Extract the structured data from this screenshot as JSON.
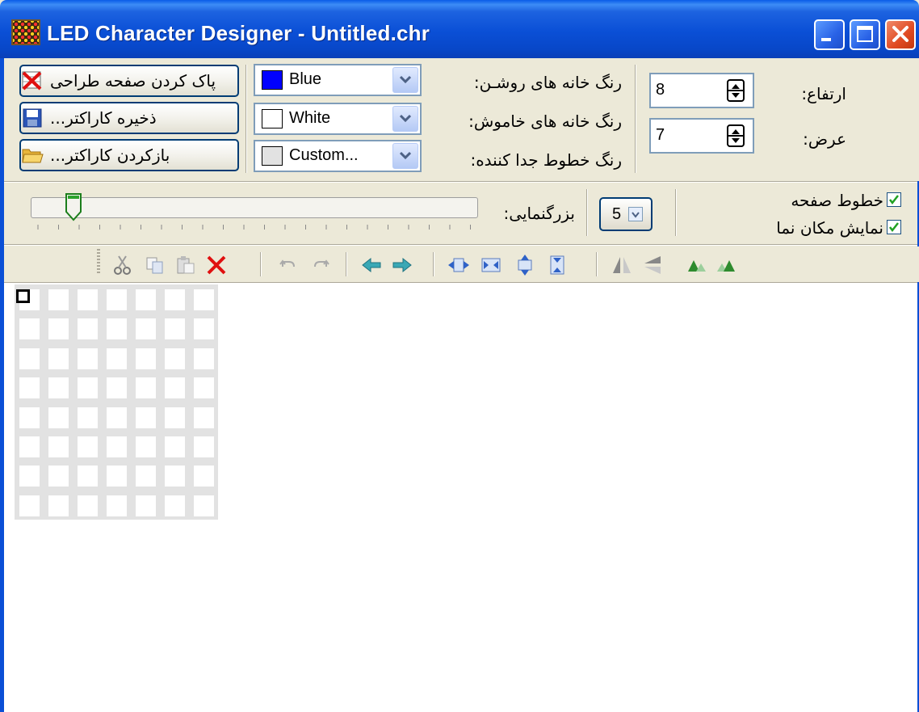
{
  "window": {
    "title": "LED Character Designer - Untitled.chr",
    "buttons": {
      "minimize": "minimize",
      "maximize": "maximize",
      "close": "close"
    }
  },
  "actions": {
    "clear_label": "پاک کردن صفحه طراحی",
    "save_label": "ذخیره کاراکتر...",
    "open_label": "بازکردن کاراکتر..."
  },
  "colors": {
    "on_cell": {
      "label": "رنگ خانه های روشـن:",
      "value": "Blue",
      "swatch": "#0000ff"
    },
    "off_cell": {
      "label": "رنگ خانه های خاموش:",
      "value": "White",
      "swatch": "#ffffff"
    },
    "separator": {
      "label": "رنگ خطوط جدا کننده:",
      "value": "Custom...",
      "swatch": "#e2e2e2"
    }
  },
  "size": {
    "height_label": "ارتفاع:",
    "height_value": "8",
    "width_label": "عرض:",
    "width_value": "7"
  },
  "zoom": {
    "label": "بزرگنمایی:",
    "value": "5",
    "slider_level": 0.09
  },
  "options": {
    "grid_lines": {
      "label": "خطوط صفحه",
      "checked": true
    },
    "show_cursor": {
      "label": "نمایش مکان نما",
      "checked": true
    }
  },
  "toolbar": {
    "icons": [
      "cut-icon",
      "copy-icon",
      "paste-icon",
      "delete-icon",
      "undo-icon",
      "redo-icon",
      "shift-left-icon",
      "shift-right-icon",
      "expand-horizontal-icon",
      "shrink-horizontal-icon",
      "expand-vertical-icon",
      "shrink-vertical-icon",
      "flip-horizontal-icon",
      "flip-vertical-icon",
      "rotate-left-icon",
      "rotate-right-icon"
    ]
  },
  "design_grid": {
    "rows": 8,
    "cols": 7
  }
}
